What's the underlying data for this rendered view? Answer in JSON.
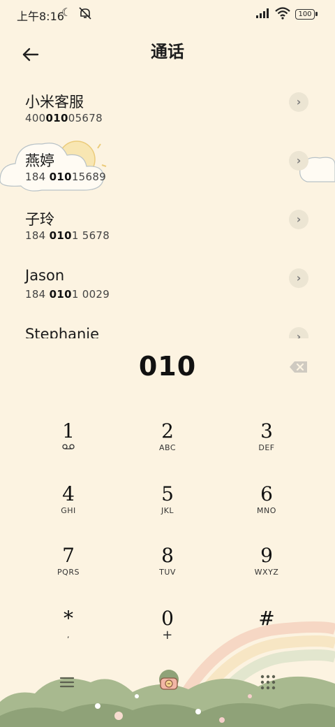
{
  "status_bar": {
    "time": "上午8:16",
    "battery": "100"
  },
  "header": {
    "title": "通话"
  },
  "contacts": [
    {
      "name": "小米客服",
      "num_pre": "400",
      "num_match": "010",
      "num_post": "05678"
    },
    {
      "name": "燕婷",
      "num_pre": "184 ",
      "num_match": "010",
      "num_post": "15689"
    },
    {
      "name": "子玲",
      "num_pre": "184 ",
      "num_match": "010",
      "num_post": "1 5678"
    },
    {
      "name": "Jason",
      "num_pre": "184 ",
      "num_match": "010",
      "num_post": "1 0029"
    },
    {
      "name": "Stephanie",
      "num_pre": "",
      "num_match": "",
      "num_post": ""
    }
  ],
  "dialer": {
    "number": "010"
  },
  "keypad": [
    {
      "digit": "1",
      "letters": ""
    },
    {
      "digit": "2",
      "letters": "ABC"
    },
    {
      "digit": "3",
      "letters": "DEF"
    },
    {
      "digit": "4",
      "letters": "GHI"
    },
    {
      "digit": "5",
      "letters": "JKL"
    },
    {
      "digit": "6",
      "letters": "MNO"
    },
    {
      "digit": "7",
      "letters": "PQRS"
    },
    {
      "digit": "8",
      "letters": "TUV"
    },
    {
      "digit": "9",
      "letters": "WXYZ"
    },
    {
      "digit": "*",
      "letters": ","
    },
    {
      "digit": "0",
      "letters": "+"
    },
    {
      "digit": "#",
      "letters": ""
    }
  ],
  "icons": {
    "back": "arrow-left-icon",
    "chevron": "chevron-right-icon",
    "backspace": "backspace-icon",
    "voicemail": "voicemail-icon",
    "menu": "menu-icon",
    "keypad": "keypad-grid-icon",
    "call": "call-icon"
  },
  "colors": {
    "background": "#FCF3E1",
    "chevron_bg": "#ECE5D3",
    "hill_green": "#9CAE82",
    "rainbow_pink": "#F2C9B3"
  }
}
